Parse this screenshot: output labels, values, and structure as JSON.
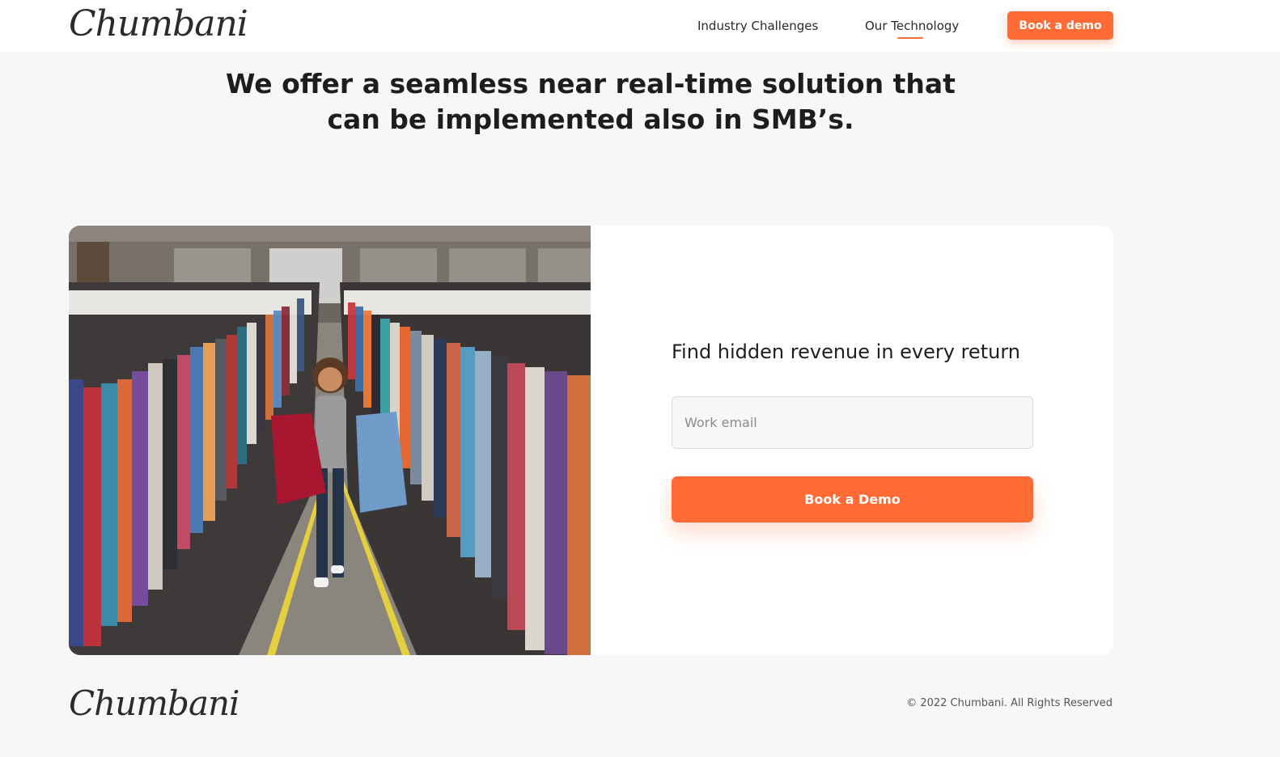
{
  "header": {
    "logo": "Chumbani",
    "nav": [
      "Industry Challenges",
      "Our Technology"
    ],
    "cta": "Book a demo"
  },
  "hero": {
    "line1": "We offer a seamless near real-time solution that",
    "line2": "can be implemented also in SMB’s."
  },
  "form": {
    "title": "Find hidden revenue in every return",
    "email_placeholder": "Work email",
    "cta": "Book a Demo"
  },
  "footer": {
    "logo": "Chumbani",
    "copyright": "© 2022 Chumbani. All Rights Reserved"
  },
  "colors": {
    "accent": "#ff6b35",
    "background": "#f7f7f7"
  }
}
